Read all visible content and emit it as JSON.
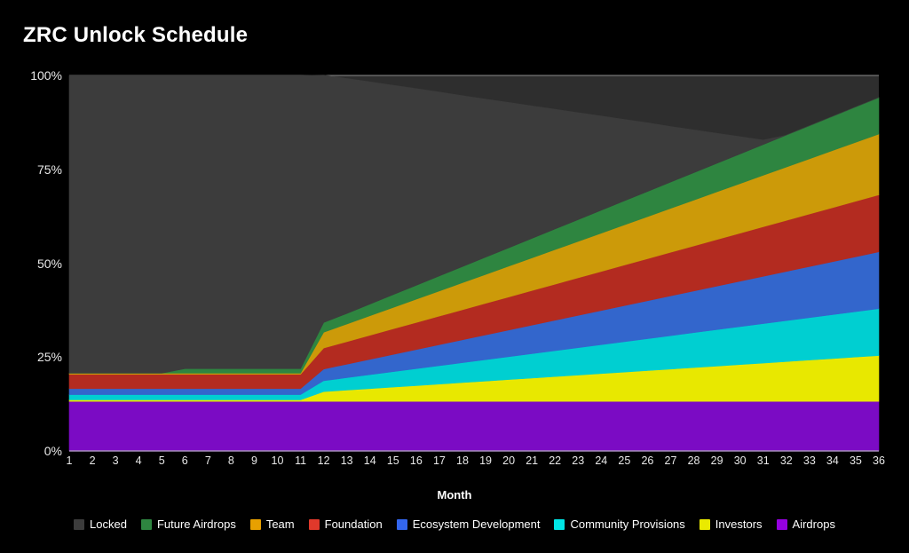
{
  "chart_data": {
    "type": "area",
    "title": "ZRC Unlock Schedule",
    "xlabel": "Month",
    "ylabel": "",
    "stacked": true,
    "percent_stacked": false,
    "grid": true,
    "legend_position": "bottom",
    "xlim": [
      1,
      36
    ],
    "ylim": [
      0,
      100
    ],
    "yticks": [
      0,
      25,
      50,
      75,
      100
    ],
    "ytick_labels": [
      "0%",
      "25%",
      "50%",
      "75%",
      "100%"
    ],
    "x": [
      1,
      2,
      3,
      4,
      5,
      6,
      7,
      8,
      9,
      10,
      11,
      12,
      13,
      14,
      15,
      16,
      17,
      18,
      19,
      20,
      21,
      22,
      23,
      24,
      25,
      26,
      27,
      28,
      29,
      30,
      31,
      32,
      33,
      34,
      35,
      36
    ],
    "categories": [
      "1",
      "2",
      "3",
      "4",
      "5",
      "6",
      "7",
      "8",
      "9",
      "10",
      "11",
      "12",
      "13",
      "14",
      "15",
      "16",
      "17",
      "18",
      "19",
      "20",
      "21",
      "22",
      "23",
      "24",
      "25",
      "26",
      "27",
      "28",
      "29",
      "30",
      "31",
      "32",
      "33",
      "34",
      "35",
      "36"
    ],
    "series": [
      {
        "name": "Airdrops",
        "color": "#7b0bc4",
        "values": [
          13.2,
          13.2,
          13.2,
          13.2,
          13.2,
          13.2,
          13.2,
          13.2,
          13.2,
          13.2,
          13.2,
          13.2,
          13.2,
          13.2,
          13.2,
          13.2,
          13.2,
          13.2,
          13.2,
          13.2,
          13.2,
          13.2,
          13.2,
          13.2,
          13.2,
          13.2,
          13.2,
          13.2,
          13.2,
          13.2,
          13.2,
          13.2,
          13.2,
          13.2,
          13.2,
          13.2
        ]
      },
      {
        "name": "Investors",
        "color": "#e8e800",
        "values": [
          0.4,
          0.4,
          0.4,
          0.4,
          0.4,
          0.4,
          0.4,
          0.4,
          0.4,
          0.4,
          0.4,
          2.6,
          3.0,
          3.4,
          3.8,
          4.2,
          4.6,
          5.0,
          5.4,
          5.8,
          6.2,
          6.6,
          7.0,
          7.4,
          7.8,
          8.2,
          8.6,
          9.0,
          9.4,
          9.8,
          10.2,
          10.6,
          11.0,
          11.4,
          11.8,
          12.2
        ]
      },
      {
        "name": "Community Provisions",
        "color": "#00cfd1",
        "values": [
          1.4,
          1.4,
          1.4,
          1.4,
          1.4,
          1.4,
          1.4,
          1.4,
          1.4,
          1.4,
          1.4,
          2.9,
          3.3,
          3.7,
          4.1,
          4.5,
          4.9,
          5.3,
          5.7,
          6.1,
          6.5,
          6.9,
          7.3,
          7.7,
          8.1,
          8.5,
          8.9,
          9.3,
          9.7,
          10.1,
          10.5,
          10.9,
          11.3,
          11.7,
          12.1,
          12.5
        ]
      },
      {
        "name": "Ecosystem Development",
        "color": "#3366cc",
        "values": [
          1.6,
          1.6,
          1.6,
          1.6,
          1.6,
          1.6,
          1.6,
          1.6,
          1.6,
          1.6,
          1.6,
          3.1,
          3.6,
          4.1,
          4.6,
          5.1,
          5.6,
          6.1,
          6.6,
          7.1,
          7.6,
          8.1,
          8.6,
          9.1,
          9.6,
          10.1,
          10.6,
          11.1,
          11.6,
          12.1,
          12.6,
          13.1,
          13.6,
          14.1,
          14.6,
          15.1
        ]
      },
      {
        "name": "Foundation",
        "color": "#b32b20",
        "values": [
          3.8,
          3.8,
          3.8,
          3.8,
          3.8,
          3.8,
          3.8,
          3.8,
          3.8,
          3.8,
          3.8,
          5.6,
          6.0,
          6.4,
          6.8,
          7.2,
          7.6,
          8.0,
          8.4,
          8.8,
          9.2,
          9.6,
          10.0,
          10.4,
          10.8,
          11.2,
          11.6,
          12.0,
          12.4,
          12.8,
          13.2,
          13.6,
          14.0,
          14.4,
          14.8,
          15.2
        ]
      },
      {
        "name": "Team",
        "color": "#cc9a09",
        "values": [
          0.3,
          0.3,
          0.3,
          0.3,
          0.3,
          0.3,
          0.3,
          0.3,
          0.3,
          0.3,
          0.3,
          4.2,
          4.7,
          5.2,
          5.7,
          6.2,
          6.7,
          7.2,
          7.7,
          8.2,
          8.7,
          9.2,
          9.7,
          10.2,
          10.7,
          11.2,
          11.7,
          12.2,
          12.7,
          13.2,
          13.7,
          14.2,
          14.7,
          15.2,
          15.7,
          16.2
        ]
      },
      {
        "name": "Future Airdrops",
        "color": "#2e8540",
        "values": [
          0.0,
          0.0,
          0.0,
          0.0,
          0.0,
          1.2,
          1.2,
          1.2,
          1.2,
          1.2,
          1.2,
          2.6,
          2.8,
          3.1,
          3.4,
          3.7,
          4.0,
          4.3,
          4.6,
          4.9,
          5.2,
          5.5,
          5.8,
          6.1,
          6.4,
          6.7,
          7.0,
          7.3,
          7.6,
          7.9,
          8.2,
          8.5,
          8.8,
          9.1,
          9.4,
          9.7
        ]
      },
      {
        "name": "Locked",
        "color": "#3c3c3c",
        "values": [
          79.3,
          79.3,
          79.3,
          79.3,
          79.3,
          78.1,
          78.1,
          78.1,
          78.1,
          78.1,
          78.1,
          65.9,
          62.6,
          59.2,
          55.8,
          52.4,
          49.0,
          45.5,
          42.1,
          38.7,
          35.3,
          31.9,
          28.5,
          25.1,
          21.7,
          18.3,
          14.8,
          11.4,
          8.0,
          4.6,
          1.2,
          0.0,
          0.0,
          0.0,
          0.0,
          0.0
        ]
      }
    ]
  },
  "legend": {
    "items": [
      {
        "label": "Locked",
        "color": "#3c3c3c"
      },
      {
        "label": "Future Airdrops",
        "color": "#2e8540"
      },
      {
        "label": "Team",
        "color": "#e8a000"
      },
      {
        "label": "Foundation",
        "color": "#e0392b"
      },
      {
        "label": "Ecosystem Development",
        "color": "#3366ee"
      },
      {
        "label": "Community Provisions",
        "color": "#00e5e5"
      },
      {
        "label": "Investors",
        "color": "#eaea00"
      },
      {
        "label": "Airdrops",
        "color": "#9500e0"
      }
    ]
  },
  "axes": {
    "background": "#000000",
    "plot_background": "#2e2e2e",
    "gridline_color": "#8c8c8c",
    "tick_text_color": "#e8e8e8"
  }
}
